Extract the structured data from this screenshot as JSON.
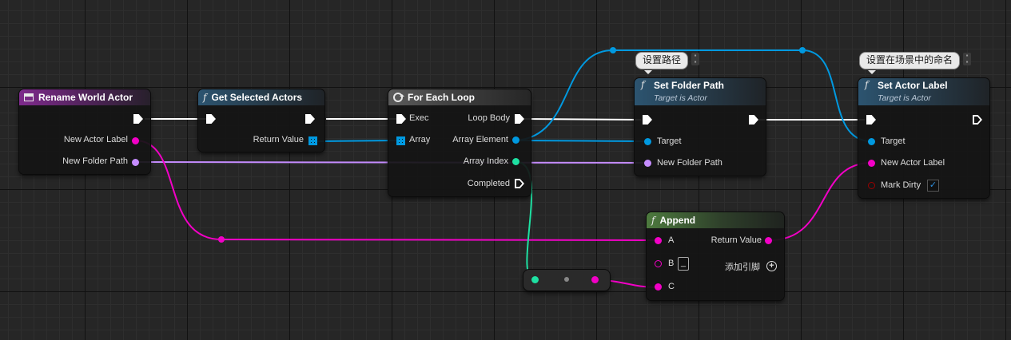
{
  "colors": {
    "exec": "#ffffff",
    "object": "#0099e0",
    "string": "#f200c6",
    "name": "#c58cff",
    "integer": "#1ee0a2",
    "bool": "#9b0000"
  },
  "nodes": {
    "rename_world_actor": {
      "title": "Rename World Actor",
      "pins": {
        "new_actor_label": "New Actor Label",
        "new_folder_path": "New Folder Path"
      }
    },
    "get_selected_actors": {
      "title": "Get Selected Actors",
      "pins": {
        "return_value": "Return Value"
      }
    },
    "for_each_loop": {
      "title": "For Each Loop",
      "pins": {
        "exec": "Exec",
        "array": "Array",
        "loop_body": "Loop Body",
        "array_element": "Array Element",
        "array_index": "Array Index",
        "completed": "Completed"
      }
    },
    "set_folder_path": {
      "title": "Set Folder Path",
      "subtitle": "Target is Actor",
      "comment": "设置路径",
      "pins": {
        "target": "Target",
        "new_folder_path": "New Folder Path"
      }
    },
    "set_actor_label": {
      "title": "Set Actor Label",
      "subtitle": "Target is Actor",
      "comment": "设置在场景中的命名",
      "pins": {
        "target": "Target",
        "new_actor_label": "New Actor Label",
        "mark_dirty": "Mark Dirty"
      },
      "mark_dirty_checked": true
    },
    "append": {
      "title": "Append",
      "pins": {
        "a": "A",
        "b": "B",
        "c": "C",
        "return_value": "Return Value",
        "add_pin": "添加引脚"
      },
      "b_value": "_"
    }
  }
}
